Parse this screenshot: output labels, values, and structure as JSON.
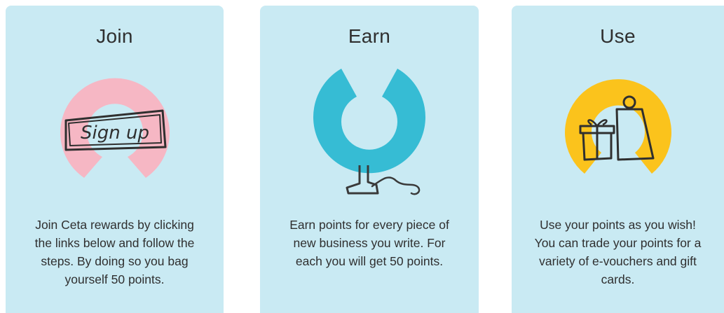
{
  "cards": [
    {
      "title": "Join",
      "image_text": "Sign up",
      "illustration": "sign-up-badge",
      "accent_color": "#f6b7c4",
      "lines": [
        "Join Ceta rewards by clicking",
        "the links below and follow the",
        "steps. By doing so you bag",
        "yourself 50 points."
      ]
    },
    {
      "title": "Earn",
      "illustration": "lever-pen",
      "accent_color": "#36bcd4",
      "lines": [
        "Earn points for every piece of",
        "new business you write. For",
        "each you will get 50 points."
      ]
    },
    {
      "title": "Use",
      "illustration": "gift-and-shopping-bag",
      "accent_color": "#fbc31c",
      "lines": [
        "Use your points as you wish!",
        "You can trade your points for a",
        "variety of e-vouchers and gift",
        "cards."
      ]
    }
  ]
}
